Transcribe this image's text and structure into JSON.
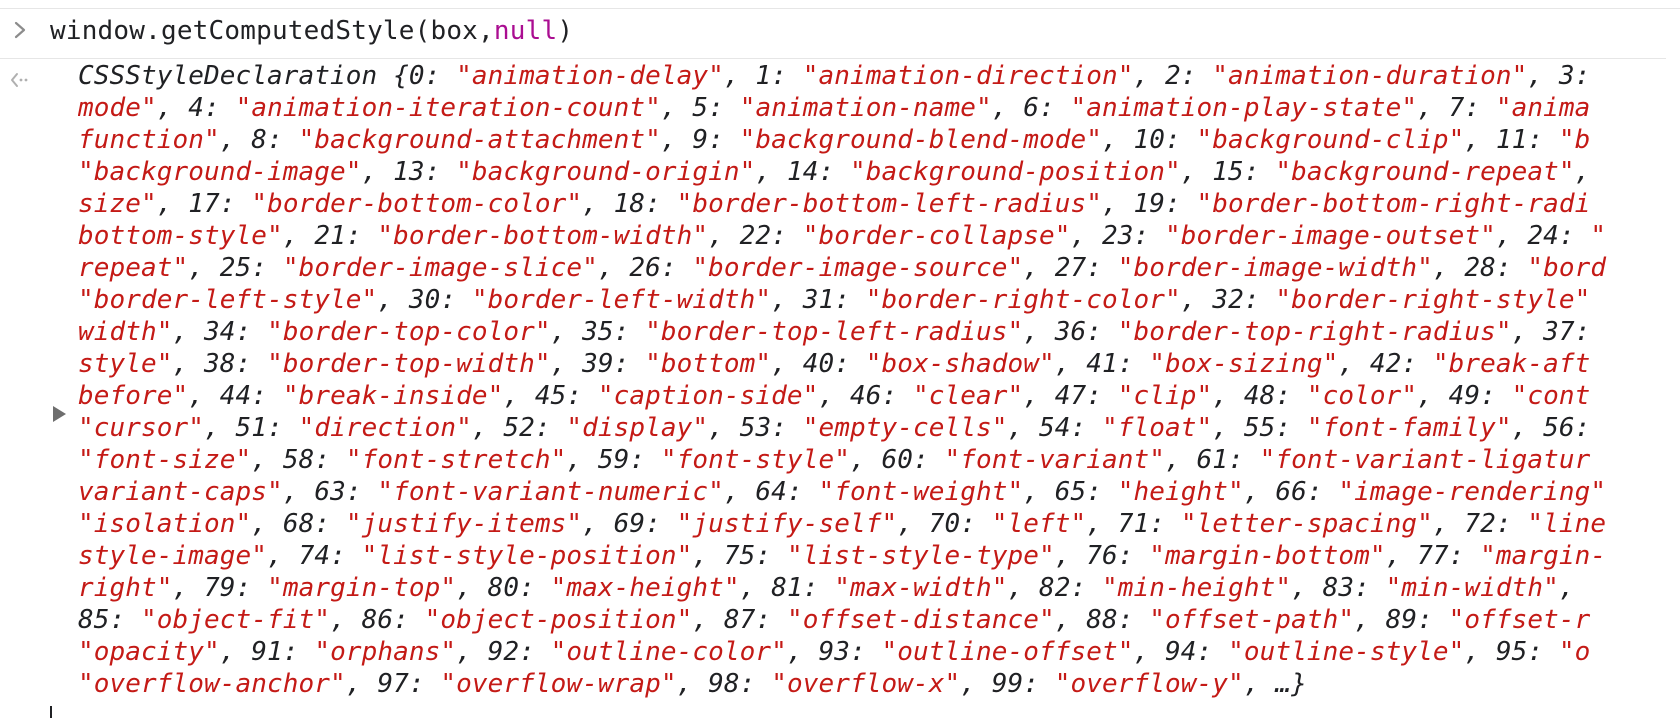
{
  "console": {
    "command_prefix": "window.getComputedStyle(box,",
    "command_null": "null",
    "command_suffix": ")",
    "object_lines": [
      "CSSStyleDeclaration {0: \"animation-delay\", 1: \"animation-direction\", 2: \"animation-duration\", 3: ",
      "mode\", 4: \"animation-iteration-count\", 5: \"animation-name\", 6: \"animation-play-state\", 7: \"anima",
      "function\", 8: \"background-attachment\", 9: \"background-blend-mode\", 10: \"background-clip\", 11: \"b",
      "\"background-image\", 13: \"background-origin\", 14: \"background-position\", 15: \"background-repeat\", ",
      "size\", 17: \"border-bottom-color\", 18: \"border-bottom-left-radius\", 19: \"border-bottom-right-radi",
      "bottom-style\", 21: \"border-bottom-width\", 22: \"border-collapse\", 23: \"border-image-outset\", 24: \"",
      "repeat\", 25: \"border-image-slice\", 26: \"border-image-source\", 27: \"border-image-width\", 28: \"bord",
      "\"border-left-style\", 30: \"border-left-width\", 31: \"border-right-color\", 32: \"border-right-style\"",
      "width\", 34: \"border-top-color\", 35: \"border-top-left-radius\", 36: \"border-top-right-radius\", 37: ",
      "style\", 38: \"border-top-width\", 39: \"bottom\", 40: \"box-shadow\", 41: \"box-sizing\", 42: \"break-aft",
      "before\", 44: \"break-inside\", 45: \"caption-side\", 46: \"clear\", 47: \"clip\", 48: \"color\", 49: \"cont",
      "\"cursor\", 51: \"direction\", 52: \"display\", 53: \"empty-cells\", 54: \"float\", 55: \"font-family\", 56: ",
      "\"font-size\", 58: \"font-stretch\", 59: \"font-style\", 60: \"font-variant\", 61: \"font-variant-ligatur",
      "variant-caps\", 63: \"font-variant-numeric\", 64: \"font-weight\", 65: \"height\", 66: \"image-rendering\"",
      "\"isolation\", 68: \"justify-items\", 69: \"justify-self\", 70: \"left\", 71: \"letter-spacing\", 72: \"line",
      "style-image\", 74: \"list-style-position\", 75: \"list-style-type\", 76: \"margin-bottom\", 77: \"margin-",
      "right\", 79: \"margin-top\", 80: \"max-height\", 81: \"max-width\", 82: \"min-height\", 83: \"min-width\", ",
      "85: \"object-fit\", 86: \"object-position\", 87: \"offset-distance\", 88: \"offset-path\", 89: \"offset-r",
      "\"opacity\", 91: \"orphans\", 92: \"outline-color\", 93: \"outline-offset\", 94: \"outline-style\", 95: \"o",
      "\"overflow-anchor\", 97: \"overflow-wrap\", 98: \"overflow-x\", 99: \"overflow-y\", …}"
    ]
  },
  "icons": {
    "prompt": "chevron-right-icon",
    "result": "result-arrow-icon",
    "expand": "expand-triangle-icon"
  },
  "colors": {
    "string_value": "#c41a16",
    "key_text": "#202124",
    "null_keyword": "#aa0d91",
    "icon_gray": "#8c8c8c"
  }
}
